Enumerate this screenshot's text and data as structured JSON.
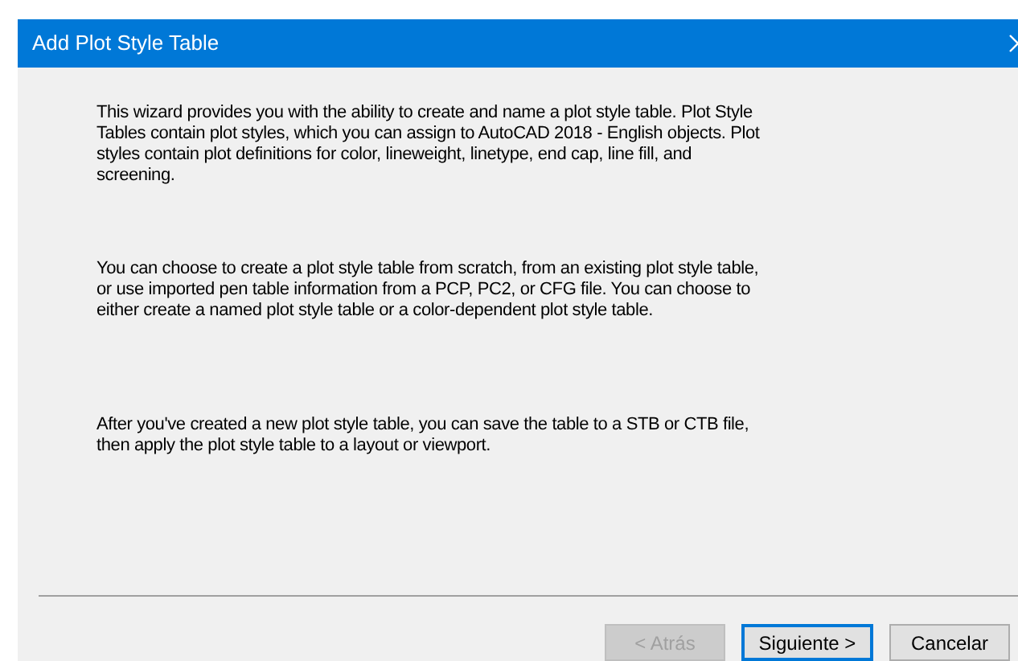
{
  "window": {
    "title": "Add Plot Style Table"
  },
  "paragraphs": [
    "This wizard provides you with the ability to create and name a plot style table. Plot Style Tables contain plot styles, which you can assign to AutoCAD 2018 - English objects. Plot styles contain plot definitions for color, lineweight, linetype, end cap, line fill, and screening.",
    "You can choose to create a plot style table from scratch, from an existing plot style table, or use imported pen table information from a PCP, PC2, or CFG file. You can choose to either create a named plot style table or a color-dependent plot style table.",
    "After you've created a new plot style table, you can save the table to a STB or CTB file, then apply the plot style table to a layout or viewport."
  ],
  "buttons": [
    {
      "label": "< Atrás",
      "disabled": true,
      "default": false
    },
    {
      "label": "Siguiente >",
      "disabled": false,
      "default": true
    },
    {
      "label": "Cancelar",
      "disabled": false,
      "default": false
    }
  ]
}
